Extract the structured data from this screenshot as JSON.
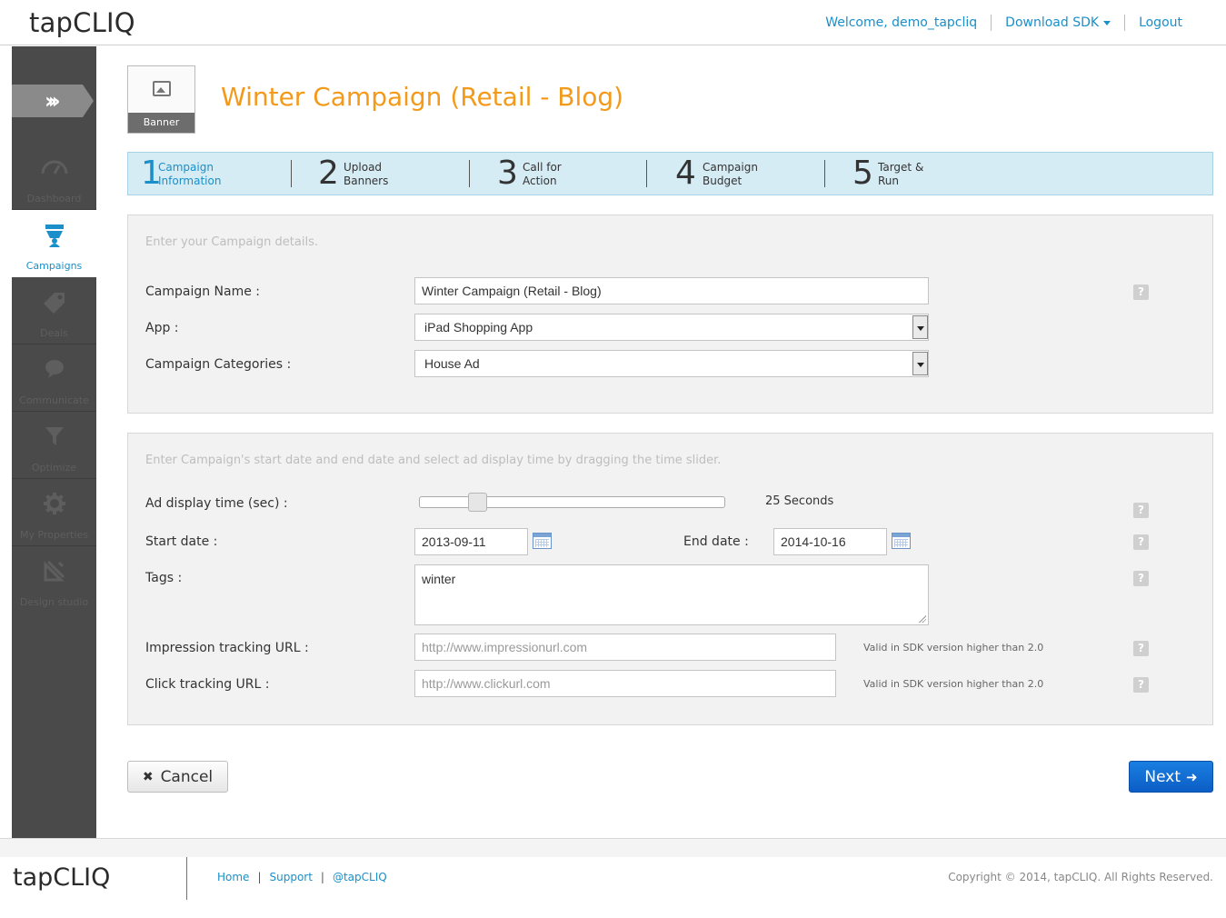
{
  "header": {
    "logo": "tapCLIQ",
    "welcome": "Welcome, demo_tapcliq",
    "download_sdk": "Download SDK",
    "logout": "Logout"
  },
  "sidebar": {
    "items": [
      {
        "label": "Dashboard",
        "icon": "dashboard-gauge-icon"
      },
      {
        "label": "Campaigns",
        "icon": "campaigns-icon"
      },
      {
        "label": "Deals",
        "icon": "tag-icon"
      },
      {
        "label": "Communicate",
        "icon": "chat-bubble-icon"
      },
      {
        "label": "Optimize",
        "icon": "funnel-icon"
      },
      {
        "label": "My Properties",
        "icon": "gear-icon"
      },
      {
        "label": "Design studio",
        "icon": "design-tools-icon"
      }
    ],
    "active_color": "#1a8fc9"
  },
  "campaign": {
    "thumb_caption": "Banner",
    "title": "Winter Campaign (Retail - Blog)",
    "title_color": "#f39a1b"
  },
  "steps": [
    {
      "num": "1",
      "line1": "Campaign",
      "line2": "Information"
    },
    {
      "num": "2",
      "line1": "Upload",
      "line2": "Banners"
    },
    {
      "num": "3",
      "line1": "Call for",
      "line2": "Action"
    },
    {
      "num": "4",
      "line1": "Campaign",
      "line2": "Budget"
    },
    {
      "num": "5",
      "line1": "Target &",
      "line2": "Run"
    }
  ],
  "panel1": {
    "intro": "Enter your Campaign details.",
    "campaign_name_label": "Campaign Name :",
    "campaign_name_value": "Winter Campaign (Retail - Blog)",
    "app_label": "App :",
    "app_value": "iPad Shopping App",
    "categories_label": "Campaign Categories :",
    "categories_value": "House Ad"
  },
  "panel2": {
    "intro": "Enter Campaign's start date and end date and select ad display time by dragging the time slider.",
    "ad_display_label": "Ad display time (sec) :",
    "ad_display_value": "25 Seconds",
    "slider_fraction": 0.17,
    "start_label": "Start date :",
    "start_value": "2013-09-11",
    "end_label": "End date :",
    "end_value": "2014-10-16",
    "tags_label": "Tags :",
    "tags_value": "winter",
    "impression_label": "Impression tracking URL :",
    "impression_placeholder": "http://www.impressionurl.com",
    "impression_note": "Valid in SDK version higher than 2.0",
    "click_label": "Click tracking URL :",
    "click_placeholder": "http://www.clickurl.com",
    "click_note": "Valid in SDK version higher than 2.0",
    "help": "?"
  },
  "actions": {
    "cancel": "Cancel",
    "next": "Next"
  },
  "footer": {
    "logo": "tapCLIQ",
    "links": [
      "Home",
      "Support",
      "@tapCLIQ"
    ],
    "copyright": "Copyright © 2014, tapCLIQ. All Rights Reserved."
  }
}
